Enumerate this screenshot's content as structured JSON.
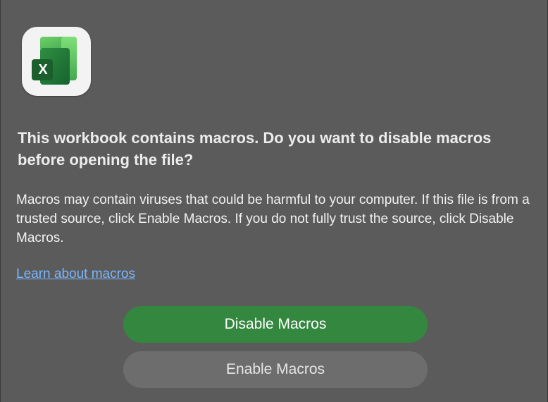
{
  "dialog": {
    "icon": "excel-app-icon",
    "icon_letter": "X",
    "title": "This workbook contains macros. Do you want to disable macros before opening the file?",
    "message": "Macros may contain viruses that could be harmful to your computer.  If this file is from a trusted source, click Enable Macros. If you do not fully trust the source, click Disable Macros.",
    "link_label": "Learn about macros",
    "primary_button_label": "Disable Macros",
    "secondary_button_label": "Enable Macros"
  },
  "colors": {
    "background": "#5b5b5b",
    "primary_button": "#34873f",
    "secondary_button": "#6d6d6d",
    "link": "#7ab6ff",
    "excel_green_dark": "#1f6b34",
    "excel_green_light": "#4fbf5a"
  }
}
